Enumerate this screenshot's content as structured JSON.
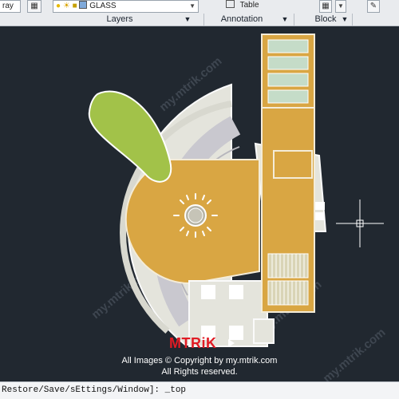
{
  "ribbon": {
    "layer_combo_left": "ray",
    "layer_combo_value": "GLASS",
    "table_label": "Table",
    "panels": {
      "layers": "Layers",
      "annotation": "Annotation",
      "block": "Block"
    }
  },
  "drawing": {
    "background_color": "#212830",
    "crosshair_color": "#ffffff"
  },
  "watermark": {
    "brand": "MTRiK",
    "line1": "All Images © Copyright by my.mtrik.com",
    "line2": "All Rights reserved.",
    "tiled_text": "my.mtrik.com"
  },
  "command_line": {
    "text": "Restore/Save/sEttings/Window]: _top"
  }
}
